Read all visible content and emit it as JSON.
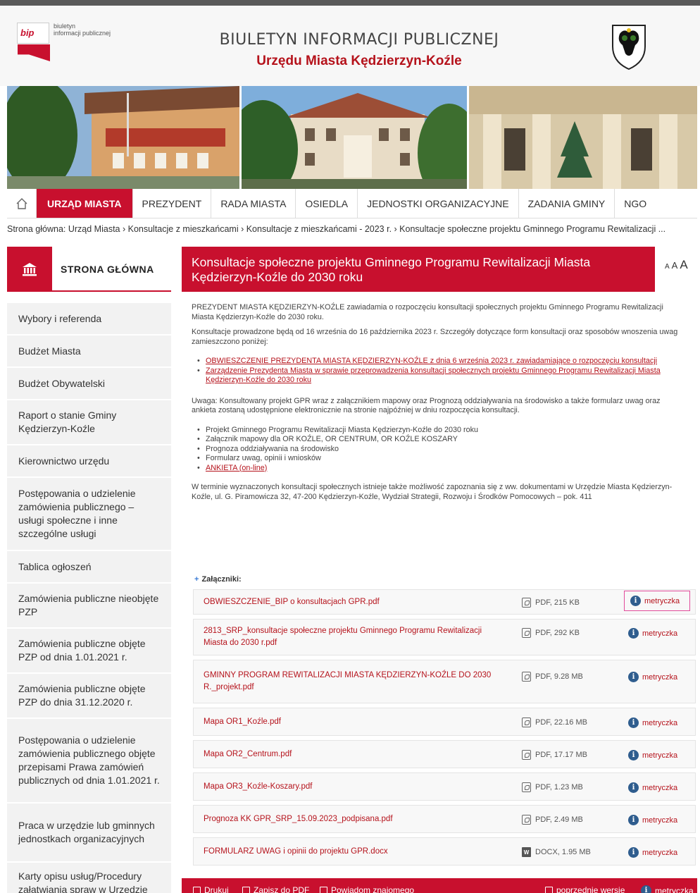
{
  "header": {
    "bip_logo_word": "bip",
    "bip_logo_line1": "biuletyn",
    "bip_logo_line2": "informacji publicznej",
    "title": "BIULETYN INFORMACJI PUBLICZNEJ",
    "subtitle": "Urzędu Miasta Kędzierzyn-Koźle"
  },
  "nav": {
    "items": [
      {
        "label": "URZĄD MIASTA",
        "active": true
      },
      {
        "label": "PREZYDENT"
      },
      {
        "label": "RADA MIASTA"
      },
      {
        "label": "OSIEDLA"
      },
      {
        "label": "JEDNOSTKI ORGANIZACYJNE"
      },
      {
        "label": "ZADANIA GMINY"
      },
      {
        "label": "NGO"
      }
    ]
  },
  "breadcrumb": "Strona główna: Urząd Miasta › Konsultacje z mieszkańcami › Konsultacje z mieszkańcami - 2023 r. › Konsultacje społeczne projektu Gminnego Programu Rewitalizacji ...",
  "sidebar": {
    "home_label": "STRONA GŁÓWNA",
    "items": [
      "Wybory i referenda",
      "Budżet Miasta",
      "Budżet Obywatelski",
      "Raport o stanie Gminy Kędzierzyn-Koźle",
      "Kierownictwo urzędu",
      "Postępowania o udzielenie zamówienia publicznego – usługi społeczne i inne szczególne usługi",
      "Tablica ogłoszeń",
      "Zamówienia publiczne nieobjęte PZP",
      "Zamówienia publiczne objęte PZP od dnia 1.01.2021 r.",
      "Zamówienia publiczne objęte PZP do dnia 31.12.2020 r.",
      "Postępowania o udzielenie zamówienia publicznego objęte przepisami Prawa zamówień publicznych od dnia 1.01.2021 r.",
      "Praca w urzędzie lub gminnych jednostkach organizacyjnych",
      "Karty opisu usług/Procedury załatwiania spraw w Urzędzie"
    ]
  },
  "main": {
    "title": "Konsultacje społeczne projektu Gminnego Programu Rewitalizacji Miasta Kędzierzyn-Koźle do 2030 roku",
    "font_sizes": [
      "A",
      "A",
      "A"
    ],
    "p1": "PREZYDENT MIASTA KĘDZIERZYN-KOŹLE zawiadamia o rozpoczęciu konsultacji społecznych projektu Gminnego Programu Rewitalizacji Miasta Kędzierzyn-Koźle do 2030 roku.",
    "p2": "Konsultacje prowadzone będą od 16 września do 16 października 2023 r. Szczegóły dotyczące form konsultacji oraz sposobów wnoszenia uwag zamieszczono poniżej:",
    "links": [
      "OBWIESZCZENIE PREZYDENTA MIASTA KĘDZIERZYN-KOŹLE z dnia 6 września 2023 r. zawiadamiające o rozpoczęciu konsultacji",
      "Zarządzenie Prezydenta Miasta w sprawie przeprowadzenia konsultacji społecznych projektu Gminnego Programu Rewitalizacji Miasta Kędzierzyn-Koźle do 2030 roku"
    ],
    "p3": "Uwaga: Konsultowany projekt GPR wraz z załącznikiem mapowy oraz Prognozą oddziaływania na środowisko a także formularz uwag oraz ankieta zostaną udostępnione elektronicznie na stronie najpóźniej w dniu rozpoczęcia konsultacji.",
    "docs": [
      "Projekt Gminnego Programu Rewitalizacji Miasta Kędzierzyn-Koźle do 2030 roku",
      "Załącznik mapowy dla OR KOŹLE, OR CENTRUM, OR KOŹLE KOSZARY",
      "Prognoza oddziaływania na środowisko",
      "Formularz uwag, opinii i wniosków"
    ],
    "survey_link": "ANKIETA (on-line)",
    "p4": "W terminie wyznaczonych konsultacji społecznych istnieje także możliwość zapoznania się z ww. dokumentami w Urzędzie Miasta Kędzierzyn-Koźle, ul. G. Piramowicza 32, 47-200 Kędzierzyn-Koźle, Wydział Strategii, Rozwoju i Środków Pomocowych – pok. 411",
    "attachments_label": "Załączniki:",
    "metryczka_label": "metryczka",
    "attachments": [
      {
        "name": "OBWIESZCZENIE_BIP o konsultacjach GPR.pdf",
        "meta": "PDF, 215 KB",
        "type": "pdf"
      },
      {
        "name": "2813_SRP_konsultacje społeczne projektu Gminnego Programu Rewitalizacji Miasta do 2030 r.pdf",
        "meta": "PDF, 292 KB",
        "type": "pdf"
      },
      {
        "name": "GMINNY PROGRAM REWITALIZACJI MIASTA KĘDZIERZYN-KOŹLE DO 2030 R._projekt.pdf",
        "meta": "PDF, 9.28 MB",
        "type": "pdf"
      },
      {
        "name": "Mapa OR1_Koźle.pdf",
        "meta": "PDF, 22.16 MB",
        "type": "pdf"
      },
      {
        "name": "Mapa OR2_Centrum.pdf",
        "meta": "PDF, 17.17 MB",
        "type": "pdf"
      },
      {
        "name": "Mapa OR3_Koźle-Koszary.pdf",
        "meta": "PDF, 1.23 MB",
        "type": "pdf"
      },
      {
        "name": "Prognoza KK GPR_SRP_15.09.2023_podpisana.pdf",
        "meta": "PDF, 2.49 MB",
        "type": "pdf"
      },
      {
        "name": "FORMULARZ UWAG i opinii do projektu GPR.docx",
        "meta": "DOCX, 1.95 MB",
        "type": "docx"
      }
    ]
  },
  "footer": {
    "print": "Drukuj",
    "save_pdf": "Zapisz do PDF",
    "notify": "Powiadom znajomego",
    "previous_version": "poprzednie wersje",
    "metryczka": "metryczka"
  },
  "colors": {
    "accent": "#c8102e",
    "link": "#b5121b",
    "info": "#2f5d8e"
  }
}
